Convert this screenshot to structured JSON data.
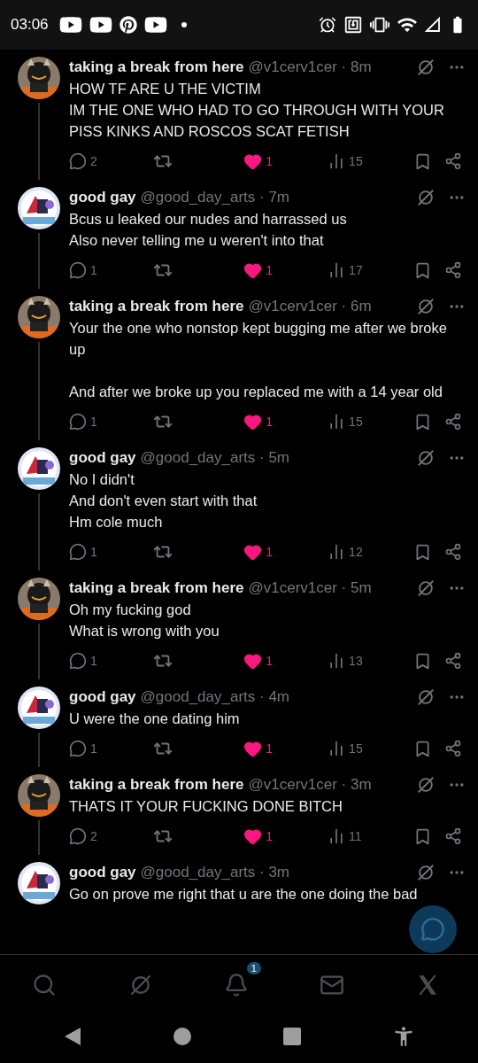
{
  "status_bar": {
    "time": "03:06",
    "notifications": [
      {
        "kind": "youtube"
      },
      {
        "kind": "youtube"
      },
      {
        "kind": "pinterest"
      },
      {
        "kind": "youtube"
      },
      {
        "kind": "dot"
      }
    ]
  },
  "tweets": [
    {
      "name": "taking a break from here",
      "meta": "@v1cerv1cer · 8m",
      "body": "HOW TF ARE U THE VICTIM\nIM THE ONE WHO HAD TO GO THROUGH WITH YOUR PISS KINKS AND ROSCOS SCAT FETISH",
      "replies": "2",
      "liked": true,
      "likes": "1",
      "views": "15"
    },
    {
      "name": "good gay",
      "meta": "@good_day_arts · 7m",
      "body": "Bcus u leaked our nudes and harrassed us\nAlso never telling me u weren't into that",
      "replies": "1",
      "liked": true,
      "likes": "1",
      "views": "17"
    },
    {
      "name": "taking a break from here",
      "meta": "@v1cerv1cer · 6m",
      "body": "Your the one who nonstop kept bugging me after we broke up\n\nAnd after we broke up you replaced me with a 14 year old",
      "replies": "1",
      "liked": true,
      "likes": "1",
      "views": "15"
    },
    {
      "name": "good gay",
      "meta": "@good_day_arts · 5m",
      "body": "No I didn't\nAnd don't even start with that\nHm cole much",
      "replies": "1",
      "liked": true,
      "likes": "1",
      "views": "12"
    },
    {
      "name": "taking a break from here",
      "meta": "@v1cerv1cer · 5m",
      "body": "Oh my fucking god\nWhat is wrong with you",
      "replies": "1",
      "liked": true,
      "likes": "1",
      "views": "13"
    },
    {
      "name": "good gay",
      "meta": "@good_day_arts · 4m",
      "body": "U were the one dating him",
      "replies": "1",
      "liked": true,
      "likes": "1",
      "views": "15"
    },
    {
      "name": "taking a break from here",
      "meta": "@v1cerv1cer · 3m",
      "body": "THATS IT YOUR FUCKING DONE BITCH",
      "replies": "2",
      "liked": true,
      "likes": "1",
      "views": "11"
    },
    {
      "name": "good gay",
      "meta": "@good_day_arts · 3m",
      "body": "Go on prove me right that u are the one doing the bad"
    }
  ],
  "tab_bar": {
    "tabs": [
      {
        "kind": "search"
      },
      {
        "kind": "grok"
      },
      {
        "kind": "notifications",
        "badge": "1"
      },
      {
        "kind": "messages"
      },
      {
        "kind": "x"
      }
    ]
  }
}
